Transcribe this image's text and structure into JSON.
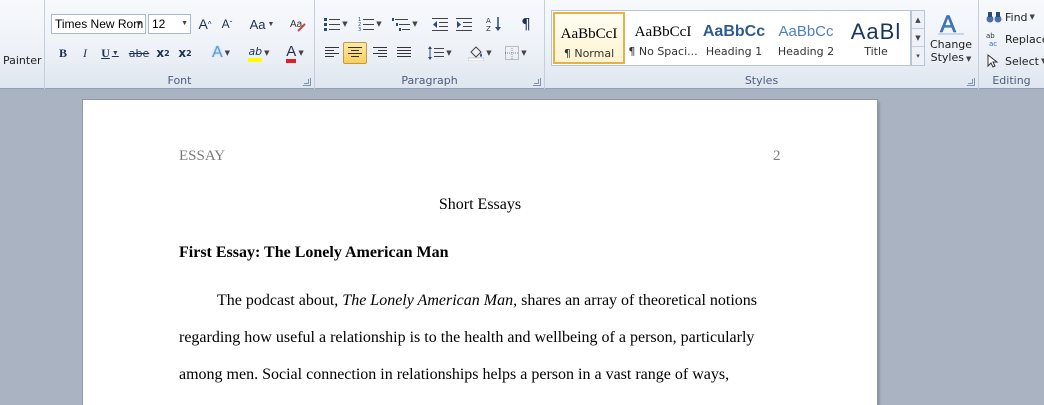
{
  "clipboard": {
    "painter_label": "Painter"
  },
  "font": {
    "group_label": "Font",
    "font_name": "Times New Rom",
    "font_size": "12",
    "grow_icon": "A",
    "shrink_icon": "A",
    "change_case": "Aa",
    "bold": "B",
    "italic": "I",
    "underline": "U",
    "strikethrough": "abe",
    "subscript": "x",
    "superscript": "x",
    "text_effects": "A",
    "highlight": "ab",
    "font_color": "A",
    "colors": {
      "highlight": "#ffff00",
      "font_color": "#e02020"
    }
  },
  "paragraph": {
    "group_label": "Paragraph",
    "pilcrow": "¶"
  },
  "styles": {
    "group_label": "Styles",
    "tiles": [
      {
        "sample": "AaBbCcI",
        "name": "¶ Normal"
      },
      {
        "sample": "AaBbCcI",
        "name": "¶ No Spaci..."
      },
      {
        "sample": "AaBbCc",
        "name": "Heading 1"
      },
      {
        "sample": "AaBbCc",
        "name": "Heading 2"
      },
      {
        "sample": "AaBl",
        "name": "Title"
      }
    ],
    "change_styles_line1": "Change",
    "change_styles_line2": "Styles"
  },
  "editing": {
    "group_label": "Editing",
    "find": "Find",
    "replace": "Replace",
    "select": "Select"
  },
  "document": {
    "header_left": "ESSAY",
    "header_page_number": "2",
    "title": "Short Essays",
    "heading": "First Essay: The Lonely American Man",
    "para_line1_before": "The podcast about, ",
    "para_line1_italic": "The Lonely American Man,",
    "para_line1_after": " shares an array of theoretical notions",
    "para_line2": "regarding how useful a relationship is to the health and wellbeing of a person, particularly",
    "para_line3": "among men. Social connection in relationships helps a person in a vast range of ways,"
  }
}
